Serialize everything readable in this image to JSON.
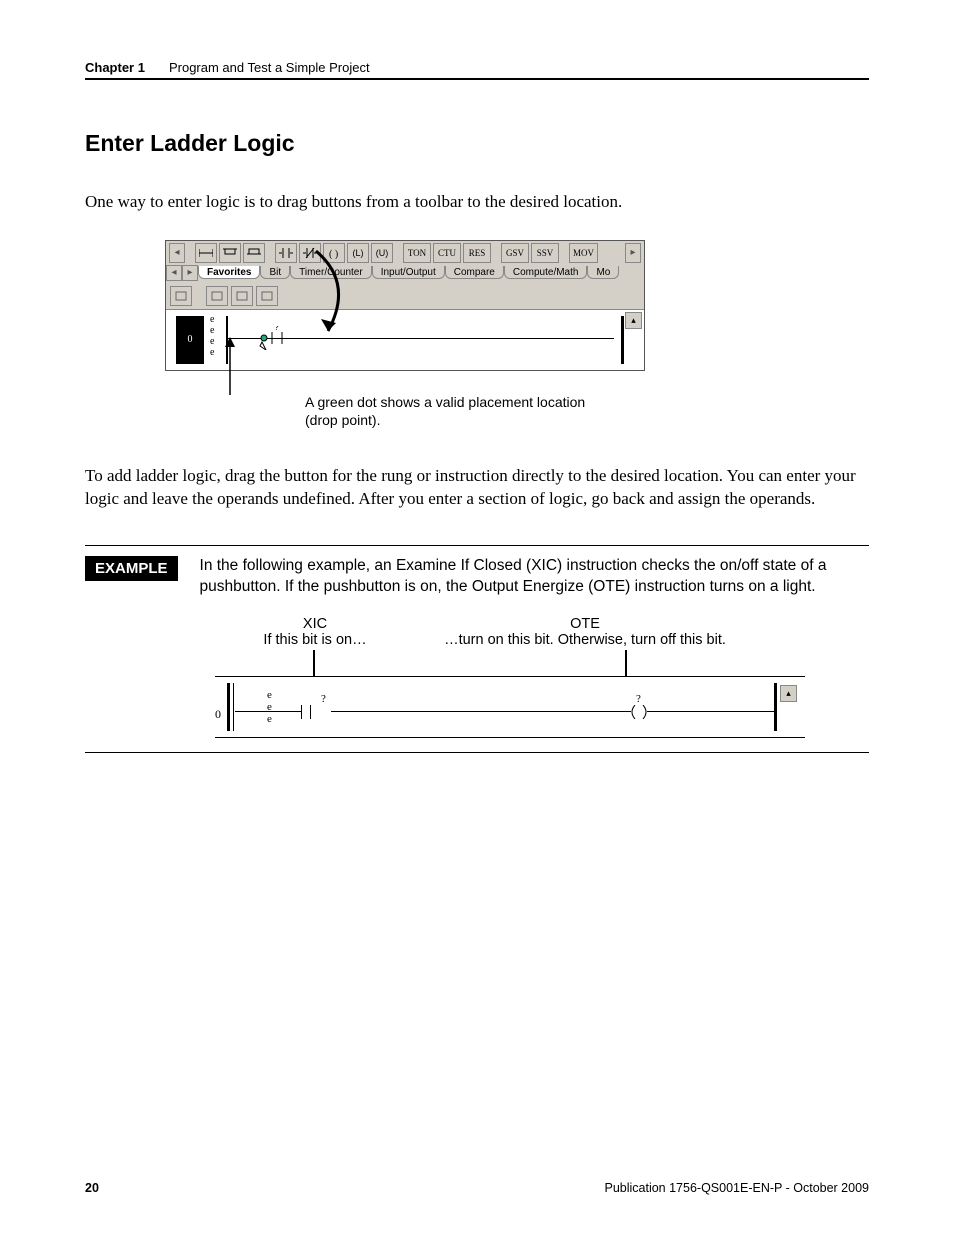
{
  "header": {
    "chapter": "Chapter 1",
    "title": "Program and Test a Simple Project"
  },
  "section_title": "Enter Ladder Logic",
  "intro_para": "One way to enter logic is to drag buttons from a toolbar to the desired location.",
  "toolbar": {
    "symbol_buttons": [
      "⊣⊢",
      "⊣∕⊢",
      "⊣ ⊢",
      "⊣ ⊢",
      "⊣⊢",
      "⊣∕⊢",
      "( )",
      "(L)",
      "(U)"
    ],
    "text_buttons": [
      "TON",
      "CTU",
      "RES",
      "GSV",
      "SSV",
      "MOV"
    ],
    "tabs": [
      "Favorites",
      "Bit",
      "Timer/Counter",
      "Input/Output",
      "Compare",
      "Compute/Math",
      "Mo"
    ],
    "rung_number": "0",
    "e_marks": "e\ne\ne\ne"
  },
  "figure_caption_line1": "A green dot shows a valid placement location",
  "figure_caption_line2": "(drop point).",
  "body_para2": "To add ladder logic, drag the button for the rung or instruction directly to the desired location. You can enter your logic and leave the operands undefined. After you enter a section of logic, go back and assign the operands.",
  "example": {
    "label": "EXAMPLE",
    "text": "In the following example, an Examine If Closed (XIC) instruction checks the on/off state of a pushbutton. If the pushbutton is on, the Output Energize (OTE) instruction turns on a light.",
    "col1_title": "XIC",
    "col1_sub": "If this bit is on…",
    "col2_title": "OTE",
    "col2_sub": "…turn on this bit. Otherwise, turn off this bit.",
    "rung_number": "0",
    "e_marks": "e\ne\ne",
    "q": "?"
  },
  "footer": {
    "page": "20",
    "pub": "Publication 1756-QS001E-EN-P - October 2009"
  }
}
